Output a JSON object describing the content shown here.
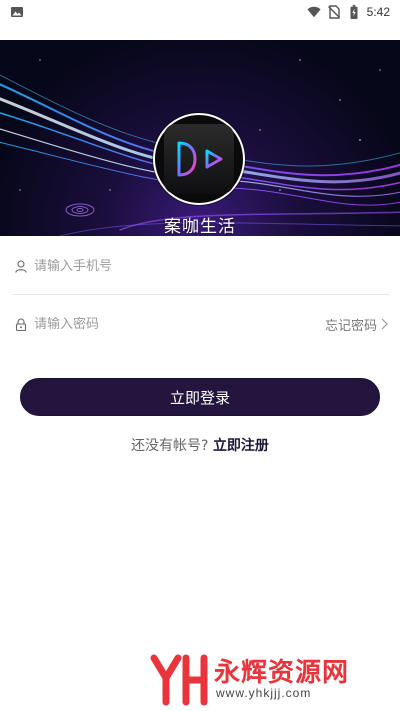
{
  "status_bar": {
    "time": "5:42",
    "icons": [
      "image-icon",
      "wifi-icon",
      "no-sim-icon",
      "battery-charging-icon"
    ]
  },
  "hero": {
    "app_name": "案咖生活",
    "logo_icon": "play-logo-icon"
  },
  "form": {
    "phone_placeholder": "请输入手机号",
    "password_placeholder": "请输入密码",
    "forgot_label": "忘记密码",
    "login_label": "立即登录",
    "no_account_text": "还没有帐号?",
    "register_label": "立即注册"
  },
  "watermark": {
    "title": "永辉资源网",
    "url": "www.yhkjjj.com"
  },
  "colors": {
    "primary_button": "#24153f",
    "watermark_red": "#e8343a"
  }
}
